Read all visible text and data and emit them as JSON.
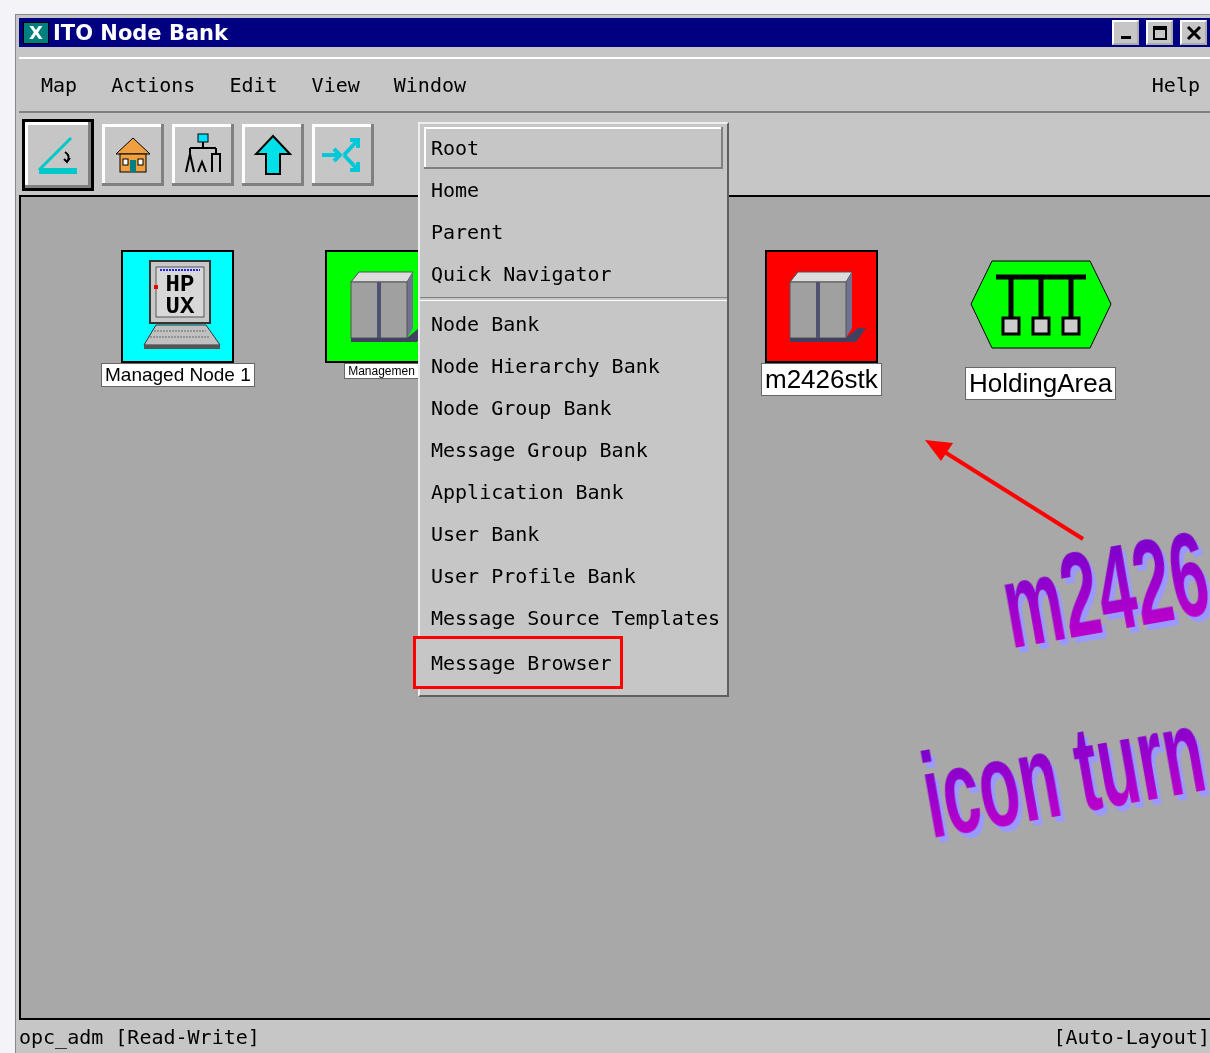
{
  "window": {
    "icon_text": "X",
    "title": "ITO Node Bank"
  },
  "menubar": [
    {
      "label": "Map"
    },
    {
      "label": "Actions"
    },
    {
      "label": "Edit"
    },
    {
      "label": "View"
    },
    {
      "label": "Window"
    }
  ],
  "help_menu": {
    "label": "Help"
  },
  "toolbar": [
    {
      "kind": "map-edit",
      "selected": true
    },
    {
      "kind": "home",
      "selected": false
    },
    {
      "kind": "hierarchy",
      "selected": false
    },
    {
      "kind": "up",
      "selected": false
    },
    {
      "kind": "navigate",
      "selected": false
    }
  ],
  "nodes": [
    {
      "kind": "workstation",
      "label": "Managed Node 1",
      "color": "#00ffff",
      "screen_text": [
        "HP",
        "UX"
      ]
    },
    {
      "kind": "server",
      "label": "Managemen",
      "color": "#00ff00"
    },
    {
      "kind": "server",
      "label": "m2426stk",
      "color": "#ff0000"
    },
    {
      "kind": "hub",
      "label": "HoldingArea",
      "color": "#00ff00"
    }
  ],
  "popup_menu": [
    {
      "kind": "item",
      "label": "Root",
      "selected": true,
      "highlighted": false
    },
    {
      "kind": "item",
      "label": "Home",
      "selected": false,
      "highlighted": false
    },
    {
      "kind": "item",
      "label": "Parent",
      "selected": false,
      "highlighted": false
    },
    {
      "kind": "item",
      "label": "Quick Navigator",
      "selected": false,
      "highlighted": false
    },
    {
      "kind": "separator"
    },
    {
      "kind": "item",
      "label": "Node Bank",
      "selected": false,
      "highlighted": false
    },
    {
      "kind": "item",
      "label": "Node Hierarchy Bank",
      "selected": false,
      "highlighted": false
    },
    {
      "kind": "item",
      "label": "Node Group Bank",
      "selected": false,
      "highlighted": false
    },
    {
      "kind": "item",
      "label": "Message Group Bank",
      "selected": false,
      "highlighted": false
    },
    {
      "kind": "item",
      "label": "Application Bank",
      "selected": false,
      "highlighted": false
    },
    {
      "kind": "item",
      "label": "User Bank",
      "selected": false,
      "highlighted": false
    },
    {
      "kind": "item",
      "label": "User Profile Bank",
      "selected": false,
      "highlighted": false
    },
    {
      "kind": "item",
      "label": "Message Source Templates",
      "selected": false,
      "highlighted": false
    },
    {
      "kind": "item",
      "label": "Message Browser",
      "selected": false,
      "highlighted": true
    }
  ],
  "annotation": {
    "lines": [
      "m2426",
      "icon turn"
    ]
  },
  "status_bar": {
    "left": "opc_adm [Read-Write]",
    "right": "[Auto-Layout]"
  }
}
